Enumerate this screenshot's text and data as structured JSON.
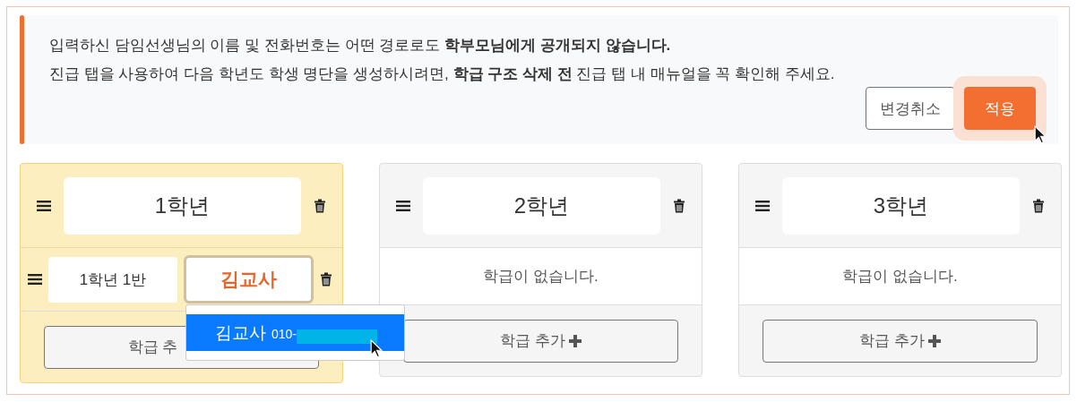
{
  "notice": {
    "lines": [
      "입력하신 담임선생님의 이름 및 전화번호는 어떤 경로로도 **학부모님에게 공개되지 않습니다.**",
      "진급 탭을 사용하여 다음 학년도 학생 명단을 생성하시려면, **학급 구조 삭제 전** 진급 탭 내 매뉴얼을 꼭 확인해 주세요."
    ],
    "buttons": [
      {
        "label": "변경취소",
        "kind": "secondary"
      },
      {
        "label": "적용",
        "kind": "primary"
      }
    ]
  },
  "grades": [
    {
      "name": "1학년",
      "selected": true,
      "classes": [
        {
          "name": "1학년 1반",
          "teacher": "김교사",
          "expanded": true
        }
      ],
      "add_label": "학급 추",
      "add_plus": false
    },
    {
      "name": "2학년",
      "selected": false,
      "empty_text": "학급이 없습니다.",
      "add_label": "학급 추가",
      "add_plus": true
    },
    {
      "name": "3학년",
      "selected": false,
      "empty_text": "학급이 없습니다.",
      "add_label": "학급 추가",
      "add_plus": true
    }
  ],
  "dropdown": {
    "options": [
      {
        "name": "김교사",
        "phone": "010-",
        "selected": true
      }
    ]
  }
}
